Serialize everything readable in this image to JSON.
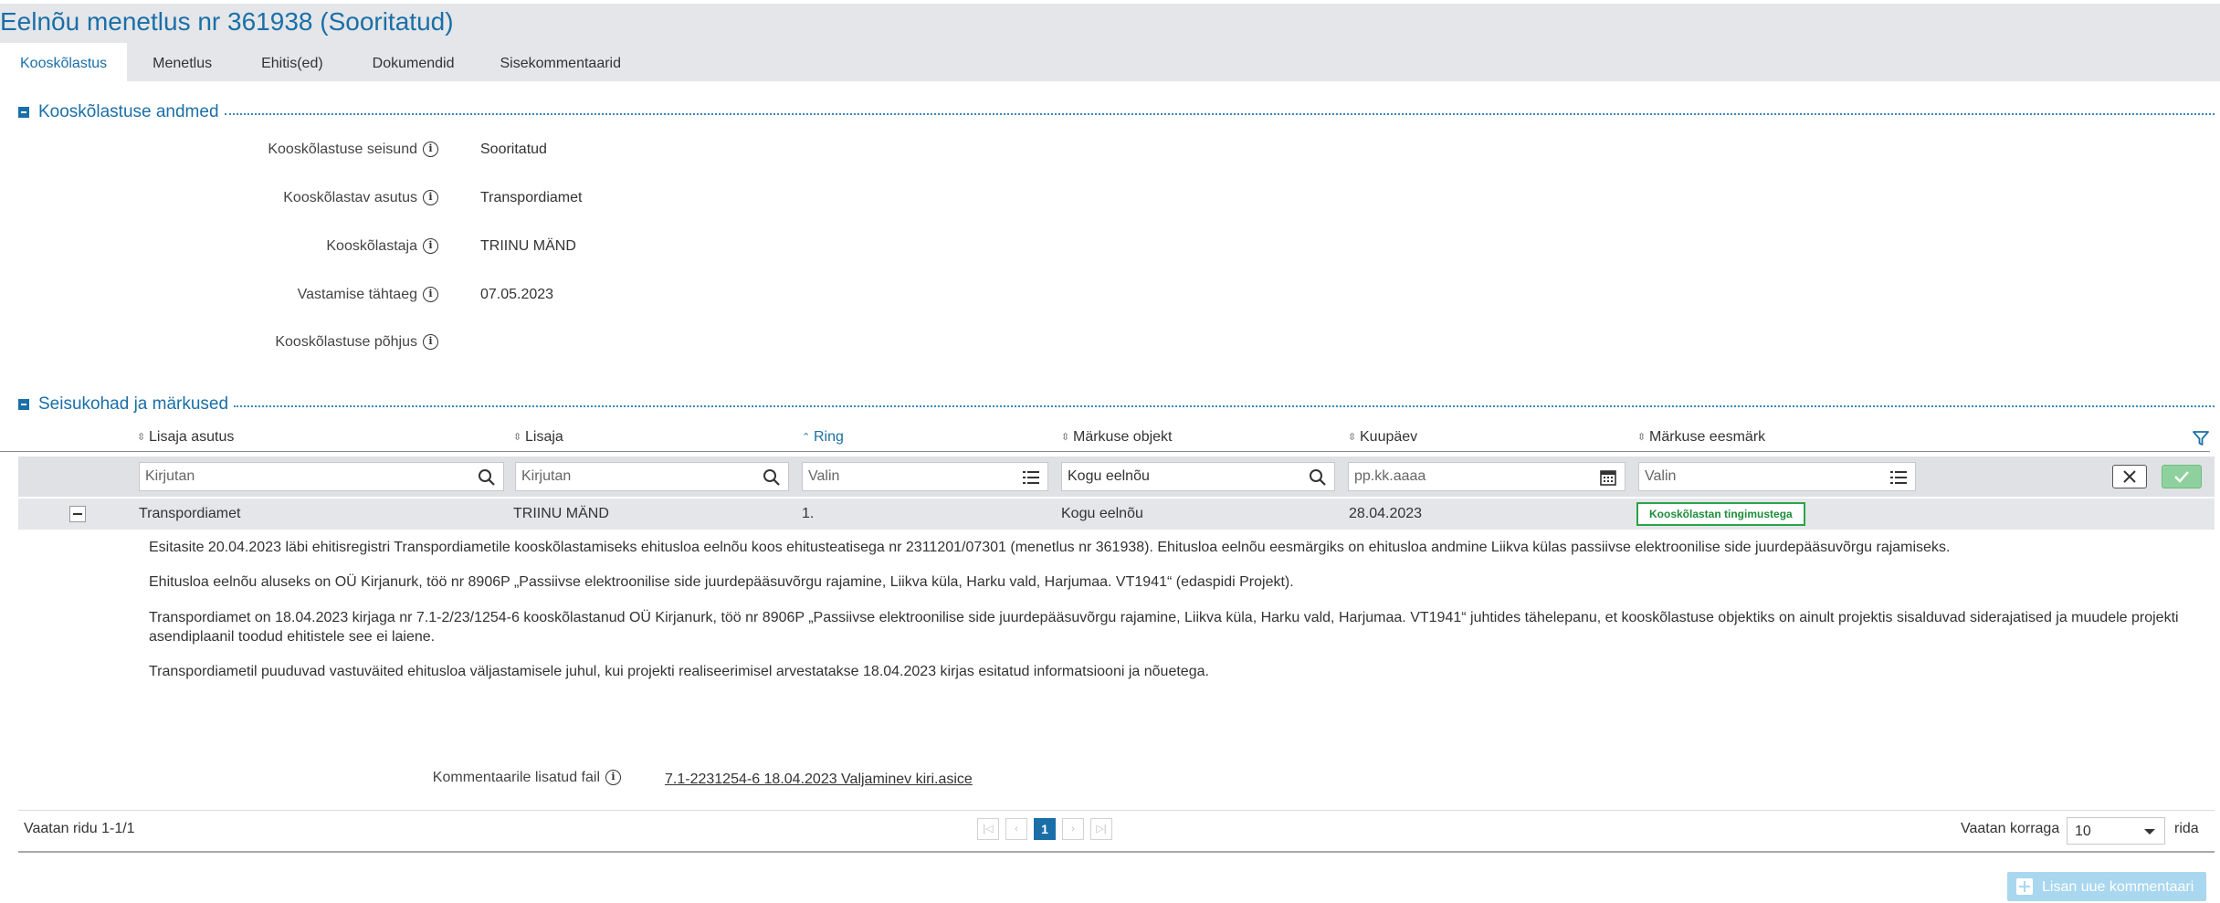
{
  "page": {
    "title": "Eelnõu menetlus nr 361938 (Sooritatud)"
  },
  "tabs": [
    {
      "label": "Kooskõlastus",
      "active": true
    },
    {
      "label": "Menetlus"
    },
    {
      "label": "Ehitis(ed)"
    },
    {
      "label": "Dokumendid"
    },
    {
      "label": "Sisekommentaarid"
    }
  ],
  "details": {
    "title": "Kooskõlastuse andmed",
    "fields": [
      {
        "label": "Kooskõlastuse seisund",
        "value": "Sooritatud"
      },
      {
        "label": "Kooskõlastav asutus",
        "value": "Transpordiamet"
      },
      {
        "label": "Kooskõlastaja",
        "value": "TRIINU MÄND"
      },
      {
        "label": "Vastamise tähtaeg",
        "value": "07.05.2023"
      },
      {
        "label": "Kooskõlastuse põhjus",
        "value": ""
      }
    ]
  },
  "remarks": {
    "title": "Seisukohad ja märkused",
    "columns": [
      "Lisaja asutus",
      "Lisaja",
      "Ring",
      "Märkuse objekt",
      "Kuupäev",
      "Märkuse eesmärk"
    ],
    "filters": {
      "agency_placeholder": "Kirjutan",
      "author_placeholder": "Kirjutan",
      "ring_placeholder": "Valin",
      "object_value": "Kogu eelnõu",
      "date_placeholder": "pp.kk.aaaa",
      "purpose_placeholder": "Valin"
    },
    "row": {
      "agency": "Transpordiamet",
      "author": "TRIINU MÄND",
      "ring": "1.",
      "object": "Kogu eelnõu",
      "date": "28.04.2023",
      "purpose": "Kooskõlastan tingimustega"
    },
    "comment_paragraphs": [
      "Esitasite 20.04.2023 läbi ehitisregistri Transpordiametile kooskõlastamiseks ehitusloa eelnõu koos ehitusteatisega nr  2311201/07301 (menetlus nr 361938). Ehitusloa eelnõu eesmärgiks on ehitusloa andmine Liikva külas passiivse elektroonilise side juurdepääsuvõrgu rajamiseks.",
      "Ehitusloa eelnõu aluseks on  OÜ Kirjanurk, töö nr 8906P „Passiivse elektroonilise side juurdepääsuvõrgu rajamine, Liikva küla, Harku vald, Harjumaa. VT1941“ (edaspidi Projekt).",
      "Transpordiamet on 18.04.2023 kirjaga nr 7.1-2/23/1254-6 kooskõlastanud OÜ Kirjanurk, töö nr 8906P „Passiivse elektroonilise side juurdepääsuvõrgu rajamine, Liikva küla, Harku vald, Harjumaa. VT1941“ juhtides tähelepanu, et kooskõlastuse objektiks on ainult projektis sisalduvad siderajatised ja muudele projekti asendiplaanil toodud ehitistele see ei laiene.",
      "Transpordiametil puuduvad vastuväited ehitusloa väljastamisele juhul, kui projekti realiseerimisel arvestatakse 18.04.2023 kirjas esitatud informatsiooni ja nõuetega."
    ],
    "attachment_label": "Kommentaarile lisatud fail",
    "attachment_file": "7.1-2231254-6 18.04.2023 Valjaminev kiri.asice"
  },
  "footer": {
    "rows_info": "Vaatan ridu 1-1/1",
    "current_page": "1",
    "per_page_label": "Vaatan korraga",
    "per_page_value": "10",
    "per_page_unit": "rida"
  },
  "add_comment_label": "Lisan uue kommentaari",
  "colors": {
    "accent": "#1a6fa8",
    "success": "#2aa34a",
    "header_bg": "#e4e6e9"
  }
}
